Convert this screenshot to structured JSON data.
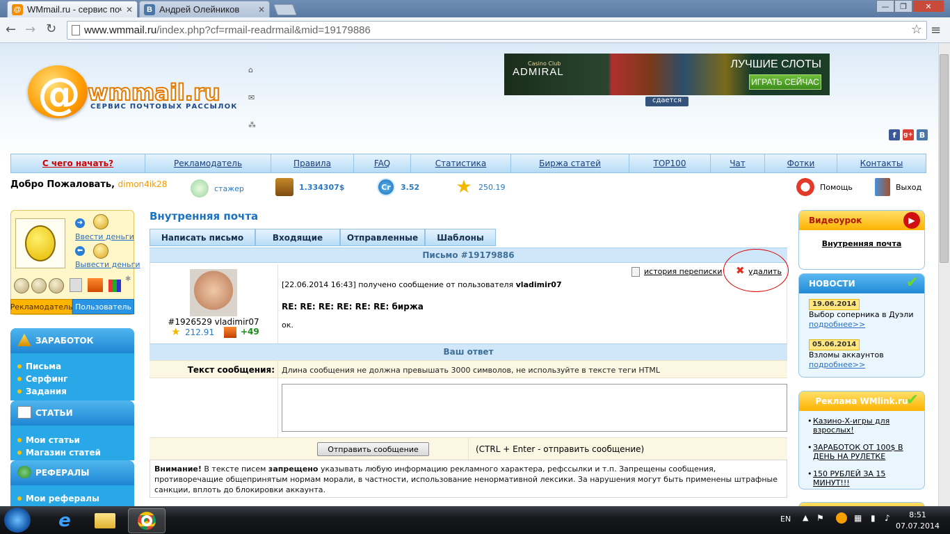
{
  "browser": {
    "tabs": [
      {
        "title": "WMmail.ru - сервис почт",
        "active": true
      },
      {
        "title": "Андрей Олейников",
        "active": false
      }
    ],
    "url_host": "www.wmmail.ru",
    "url_path": "/index.php?cf=rmail-readrmail&mid=19179886"
  },
  "header": {
    "logo_text": "wmmail.ru",
    "logo_tagline": "СЕРВИС ПОЧТОВЫХ РАССЫЛОК",
    "banner": {
      "casino_club": "Casino Club",
      "casino_name": "ADMIRAL",
      "headline": "ЛУЧШИЕ СЛОТЫ",
      "cta": "ИГРАТЬ СЕЙЧАС"
    },
    "rent_label": "сдается",
    "social": [
      "f",
      "g+",
      "B"
    ]
  },
  "nav": {
    "items": [
      {
        "label": "С чего начать?",
        "w": 193
      },
      {
        "label": "Рекламодатель",
        "w": 181
      },
      {
        "label": "Правила",
        "w": 119
      },
      {
        "label": "FAQ",
        "w": 82
      },
      {
        "label": "Статистика",
        "w": 144
      },
      {
        "label": "Биржа статей",
        "w": 170
      },
      {
        "label": "TOP100",
        "w": 117
      },
      {
        "label": "Чат",
        "w": 78
      },
      {
        "label": "Фотки",
        "w": 104
      },
      {
        "label": "Контакты",
        "w": 129
      }
    ]
  },
  "welcome": {
    "text": "Добро Пожаловать,",
    "username": "dimon4ik28",
    "status": "стажер",
    "balance": "1.334307$",
    "credits": "3.52",
    "rating": "250.19",
    "help": "Помощь",
    "logout": "Выход",
    "credits_icon_label": "Cr"
  },
  "left": {
    "deposit": "Ввести деньги",
    "withdraw": "Вывести деньги",
    "role_advertiser": "Рекламодатель",
    "role_user": "Пользователь",
    "sections": [
      {
        "title": "ЗАРАБОТОК",
        "items": [
          "Письма",
          "Серфинг",
          "Задания"
        ]
      },
      {
        "title": "СТАТЬИ",
        "items": [
          "Мои статьи",
          "Магазин статей"
        ]
      },
      {
        "title": "РЕФЕРАЛЫ",
        "items": [
          "Мои рефералы"
        ]
      }
    ]
  },
  "mail": {
    "title": "Внутренняя почта",
    "tabs": [
      "Написать письмо",
      "Входящие",
      "Отправленные",
      "Шаблоны"
    ],
    "letter_header": "Письмо #19179886",
    "sender_id": "#1926529 vladimir07",
    "sender_rating": "212.91",
    "sender_bonus": "+49",
    "history": "история переписки",
    "delete": "удалить",
    "received_prefix": "[22.06.2014 16:43] получено сообщение от пользователя",
    "received_user": "vladimir07",
    "subject": "RE: RE: RE: RE: RE: RE: биржа",
    "body": "ок.",
    "answer_header": "Ваш ответ",
    "text_label": "Текст сообщения:",
    "text_hint": "Длина сообщения не должна превышать 3000 символов, не используйте в тексте теги HTML",
    "send_button": "Отправить сообщение",
    "send_hint": "(CTRL + Enter - отправить сообщение)",
    "warning_bold1": "Внимание!",
    "warning_1": " В тексте писем ",
    "warning_bold2": "запрещено",
    "warning_2": " указывать любую информацию рекламного характера, рефссылки и т.п. Запрещены сообщения, противоречащие общепринятым нормам морали, в частности, использование ненормативной лексики. За нарушения могут быть применены штрафные санкции, вплоть до блокировки аккаунта."
  },
  "right": {
    "video_title": "Видеоурок",
    "video_link": "Внутренняя почта",
    "news_title": "НОВОСТИ",
    "news": [
      {
        "date": "19.06.2014",
        "text": "Выбор соперника в Дуэли",
        "more": "подробнее>>"
      },
      {
        "date": "05.06.2014",
        "text": "Взломы аккаунтов",
        "more": "подробнее>>"
      }
    ],
    "ads_title": "Реклама WMlink.ru",
    "ads": [
      "Казино-Х-игры для взрослых!",
      "ЗАРАБОТОК ОТ 100$ В ДЕНЬ НА РУЛЕТКЕ",
      "150 РУБЛЕЙ ЗА 15 МИНУТ!!!"
    ]
  },
  "taskbar": {
    "lang": "EN",
    "time": "8:51",
    "date": "07.07.2014"
  }
}
